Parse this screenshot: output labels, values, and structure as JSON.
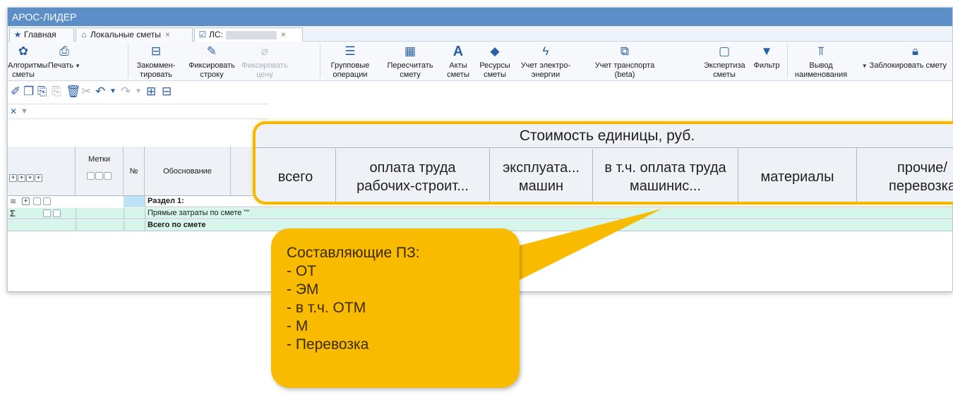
{
  "app": {
    "title": "АРОС-ЛИДЕР"
  },
  "tabs": [
    {
      "label": "Главная",
      "icon": "star-icon"
    },
    {
      "label": "Локальные сметы",
      "icon": "home-icon",
      "close": "×"
    },
    {
      "label": "ЛС:",
      "icon": "document-check-icon",
      "close": "×"
    }
  ],
  "ribbon": {
    "algorithms": "Алгоритмы сметы",
    "print": "Печать",
    "comment": "Закоммен-тировать",
    "fix_row": "Фиксировать строку",
    "fix_price": "Фиксировать цену",
    "group_ops": "Групповые операции",
    "recalc": "Пересчитать смету",
    "acts": "Акты сметы",
    "resources": "Ресурсы сметы",
    "electricity": "Учет электро-энергии",
    "transport": "Учет транспорта (beta)",
    "expertise": "Экспертиза сметы",
    "filter": "Фильтр",
    "name_output": "Вывод наименования",
    "lock": "Заблокировать смету"
  },
  "grid": {
    "headers": {
      "marks": "Метки",
      "num": "№",
      "basis": "Обоснование"
    },
    "rows": [
      {
        "text": "Раздел 1:",
        "bold": true
      },
      {
        "text": "Прямые затраты по смете \"\"",
        "bold": false
      },
      {
        "text": "Всего по смете",
        "bold": true
      }
    ]
  },
  "cost_header": {
    "title": "Стоимость единицы, руб.",
    "columns": [
      "всего",
      "оплата труда рабочих-строит...",
      "эксплуата... машин",
      "в т.ч. оплата труда машинис...",
      "материалы",
      "прочие/ перевозка"
    ]
  },
  "callout": {
    "lines": [
      "Составляющие ПЗ:",
      "- ОТ",
      "- ЭМ",
      "- в т.ч. ОТМ",
      "- М",
      "- Перевозка"
    ]
  },
  "colors": {
    "titlebar": "#5c8fc7",
    "accent": "#2b5fa3",
    "highlight": "#f5b800",
    "bubble": "#f9bb00",
    "row_mint": "#d6f6ec"
  }
}
